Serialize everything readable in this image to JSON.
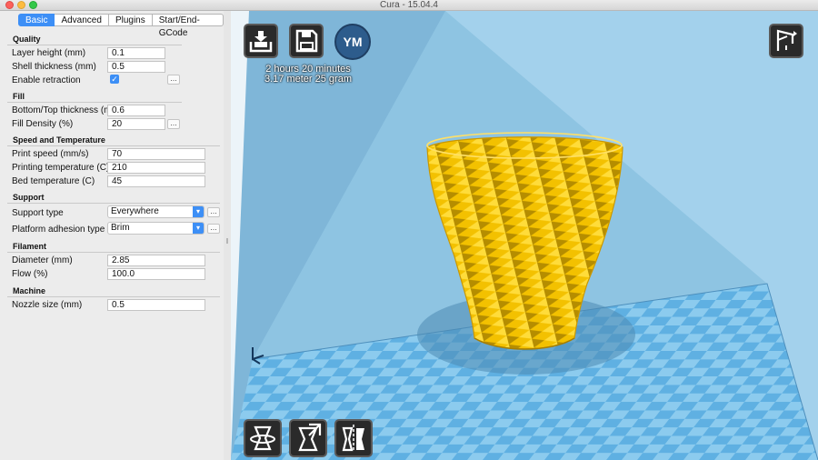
{
  "window": {
    "title": "Cura - 15.04.4"
  },
  "tabs": [
    {
      "label": "Basic",
      "active": true
    },
    {
      "label": "Advanced",
      "active": false
    },
    {
      "label": "Plugins",
      "active": false
    },
    {
      "label": "Start/End-GCode",
      "active": false
    }
  ],
  "sections": {
    "quality": {
      "title": "Quality",
      "layer_height": {
        "label": "Layer height (mm)",
        "value": "0.1"
      },
      "shell_thickness": {
        "label": "Shell thickness (mm)",
        "value": "0.5"
      },
      "enable_retraction": {
        "label": "Enable retraction",
        "checked": true,
        "more_label": "..."
      }
    },
    "fill": {
      "title": "Fill",
      "bottom_top_thickness": {
        "label": "Bottom/Top thickness (mm)",
        "value": "0.6"
      },
      "fill_density": {
        "label": "Fill Density (%)",
        "value": "20",
        "more_label": "..."
      }
    },
    "speed": {
      "title": "Speed and Temperature",
      "print_speed": {
        "label": "Print speed (mm/s)",
        "value": "70"
      },
      "printing_temperature": {
        "label": "Printing temperature (C)",
        "value": "210"
      },
      "bed_temperature": {
        "label": "Bed temperature (C)",
        "value": "45"
      }
    },
    "support": {
      "title": "Support",
      "support_type": {
        "label": "Support type",
        "value": "Everywhere",
        "more_label": "..."
      },
      "platform_adhesion": {
        "label": "Platform adhesion type",
        "value": "Brim",
        "more_label": "..."
      }
    },
    "filament": {
      "title": "Filament",
      "diameter": {
        "label": "Diameter (mm)",
        "value": "2.85"
      },
      "flow": {
        "label": "Flow (%)",
        "value": "100.0"
      }
    },
    "machine": {
      "title": "Machine",
      "nozzle_size": {
        "label": "Nozzle size (mm)",
        "value": "0.5"
      }
    }
  },
  "viewport": {
    "toolbar": {
      "load_icon": "load-model-icon",
      "save_icon": "save-gcode-icon",
      "ym_label": "YM",
      "view_mode_icon": "view-mode-icon"
    },
    "print_time": "2 hours 20 minutes",
    "material_usage": "3.17 meter 25 gram",
    "bottom_tools": [
      "rotate-icon",
      "scale-icon",
      "mirror-icon"
    ],
    "colors": {
      "model": "#f5c200",
      "platform": "#61b1e2",
      "background": "#8ec4e2",
      "ym_button": "#2d5c8c"
    }
  }
}
